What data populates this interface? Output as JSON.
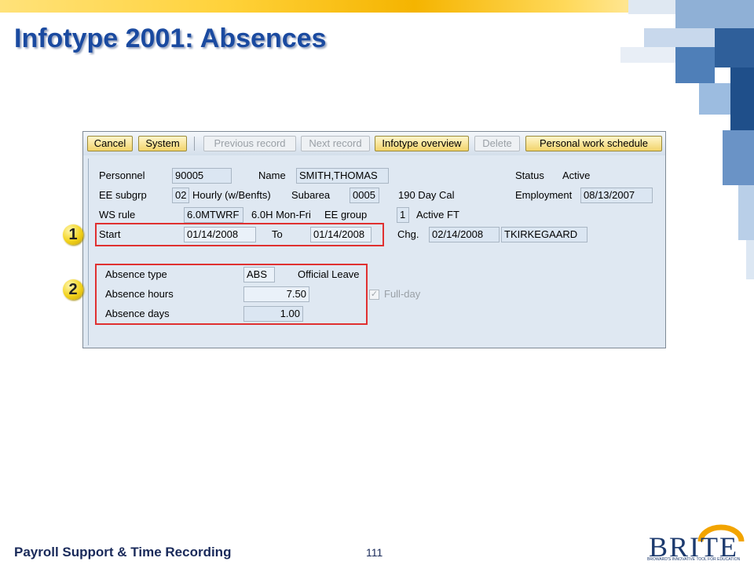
{
  "slide": {
    "title": "Infotype 2001: Absences",
    "footer": "Payroll Support & Time Recording",
    "page_number": "111",
    "logo_text": "BRITE",
    "logo_tagline": "BROWARD'S INNOVATIVE TOOL FOR EDUCATION"
  },
  "colors": {
    "title": "#1a4aa0",
    "highlight_box": "#e03030",
    "badge": "#f2d21c",
    "field_bg": "#dbe6f2"
  },
  "toolbar": {
    "cancel": "Cancel",
    "system": "System",
    "previous_record": "Previous record",
    "next_record": "Next record",
    "infotype_overview": "Infotype overview",
    "delete": "Delete",
    "personal_work_schedule": "Personal work schedule"
  },
  "header": {
    "personnel_label": "Personnel",
    "personnel_value": "90005",
    "name_label": "Name",
    "name_value": "SMITH,THOMAS",
    "status_label": "Status",
    "status_value": "Active",
    "ee_subgrp_label": "EE subgrp",
    "ee_subgrp_value": "02",
    "ee_subgrp_text": "Hourly  (w/Benfts)",
    "subarea_label": "Subarea",
    "subarea_value": "0005",
    "subarea_text": "190 Day Cal",
    "employment_label": "Employment",
    "employment_value": "08/13/2007",
    "ws_rule_label": "WS rule",
    "ws_rule_value": "6.0MTWRF",
    "ws_rule_text": "6.0H Mon-Fri",
    "ee_group_label": "EE group",
    "ee_group_value": "1",
    "ee_group_text": "Active FT"
  },
  "period": {
    "start_label": "Start",
    "start_value": "01/14/2008",
    "to_label": "To",
    "to_value": "01/14/2008",
    "chg_label": "Chg.",
    "chg_date": "02/14/2008",
    "chg_user": "TKIRKEGAARD"
  },
  "absence": {
    "type_label": "Absence type",
    "type_value": "ABS",
    "type_text": "Official Leave",
    "hours_label": "Absence hours",
    "hours_value": "7.50",
    "days_label": "Absence days",
    "days_value": "1.00",
    "full_day_label": "Full-day",
    "full_day_checked": true
  },
  "callouts": {
    "one": "1",
    "two": "2"
  }
}
